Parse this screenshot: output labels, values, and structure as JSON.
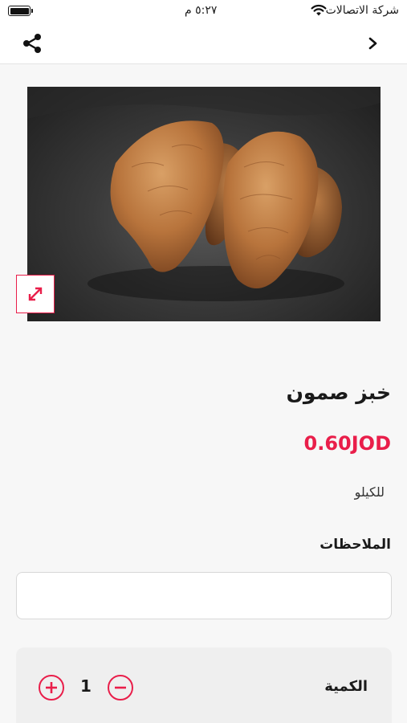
{
  "status_bar": {
    "carrier": "شركة الاتصالات",
    "time": "٥:٢٧ م",
    "battery_level": 1.0
  },
  "nav": {
    "share_icon": "share-icon",
    "back_icon": "chevron-right-icon"
  },
  "product": {
    "image_description_icon": "image",
    "expand_icon": "expand-arrows-icon",
    "name": "خبز صمون",
    "price": "0.60JOD",
    "unit": "للكيلو"
  },
  "notes": {
    "label": "الملاحظات",
    "value": ""
  },
  "quantity": {
    "label": "الكمية",
    "value": "1"
  },
  "colors": {
    "accent": "#e91e4a",
    "background": "#f7f7f7"
  }
}
